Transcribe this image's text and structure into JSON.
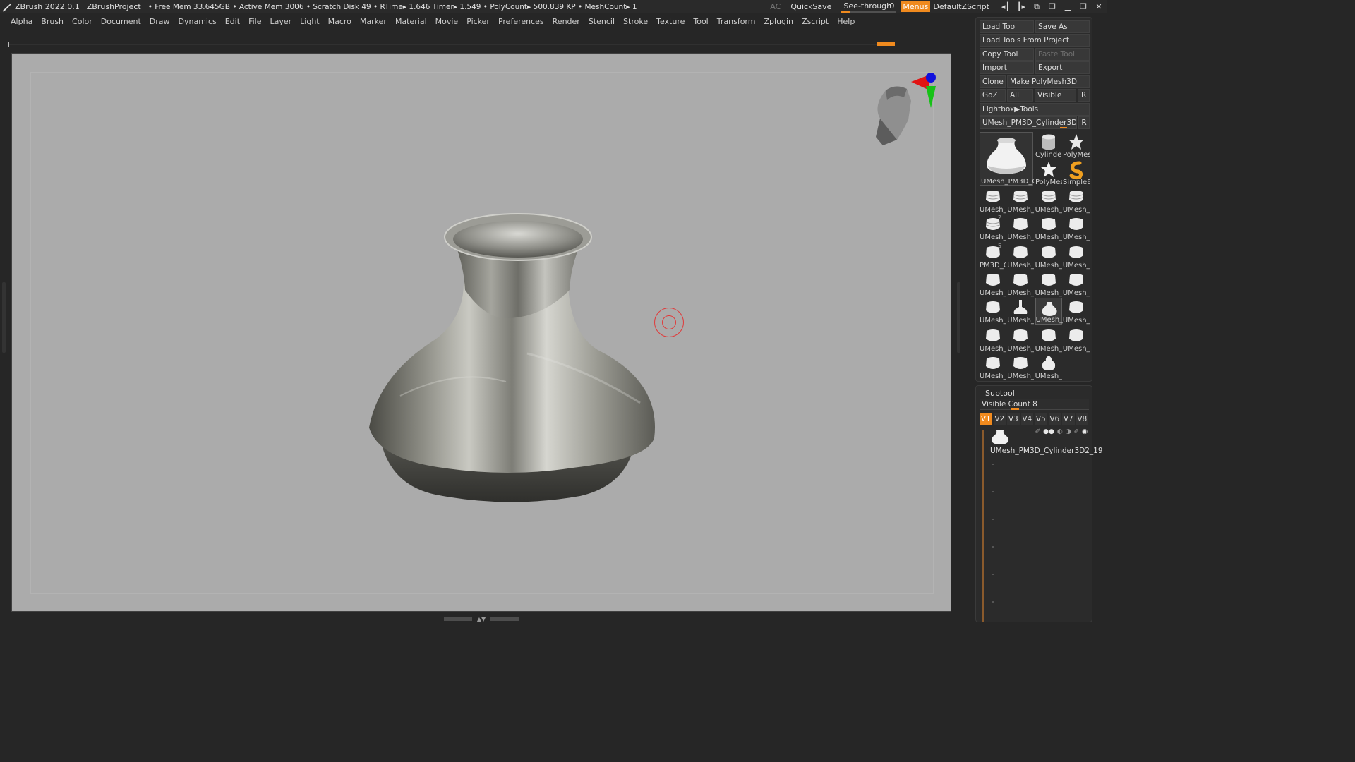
{
  "titlebar": {
    "app": "ZBrush 2022.0.1",
    "project": "ZBrushProject",
    "status": "• Free Mem 33.645GB • Active Mem 3006 • Scratch Disk 49 •  RTime▸ 1.646 Timer▸ 1.549 • PolyCount▸ 500.839 KP  • MeshCount▸ 1",
    "ac": "AC",
    "quicksave": "QuickSave",
    "see_through_label": "See-through",
    "see_through_value": "0",
    "menus": "Menus",
    "default_zscript": "DefaultZScript"
  },
  "menubar": [
    "Alpha",
    "Brush",
    "Color",
    "Document",
    "Draw",
    "Dynamics",
    "Edit",
    "File",
    "Layer",
    "Light",
    "Macro",
    "Marker",
    "Material",
    "Movie",
    "Picker",
    "Preferences",
    "Render",
    "Stencil",
    "Stroke",
    "Texture",
    "Tool",
    "Transform",
    "Zplugin",
    "Zscript",
    "Help"
  ],
  "tool_panel": {
    "load_tool": "Load Tool",
    "save_as": "Save As",
    "load_tools_from_project": "Load Tools From Project",
    "copy_tool": "Copy Tool",
    "paste_tool": "Paste Tool",
    "import": "Import",
    "export": "Export",
    "clone": "Clone",
    "make_polymesh": "Make PolyMesh3D",
    "goz": "GoZ",
    "all": "All",
    "visible": "Visible",
    "r": "R",
    "lightbox_tools": "Lightbox▶Tools",
    "current_tool": "UMesh_PM3D_Cylinder3D2_1",
    "current_tool_r": "R",
    "big_thumb_label": "UMesh_PM3D_C",
    "top_thumbs": [
      {
        "label": "Cylinder",
        "icon": "cylinder-icon"
      },
      {
        "label": "PolyMes",
        "icon": "star-icon"
      },
      {
        "label": "PolyMes",
        "icon": "star-icon"
      },
      {
        "label": "SimpleB",
        "icon": "simplebrush-icon"
      }
    ],
    "grid_thumbs": [
      "UMesh_",
      "UMesh_",
      "UMesh_",
      "UMesh_",
      "UMesh_",
      "UMesh_",
      "UMesh_",
      "UMesh_",
      "PM3D_C",
      "UMesh_",
      "UMesh_",
      "UMesh_",
      "UMesh_",
      "UMesh_",
      "UMesh_",
      "UMesh_",
      "UMesh_",
      "UMesh_",
      "UMesh_",
      "UMesh_",
      "UMesh_",
      "UMesh_",
      "UMesh_",
      "UMesh_",
      "UMesh_",
      "UMesh_",
      "UMesh_"
    ],
    "grid_badges": {
      "4": "2",
      "8": "5"
    }
  },
  "subtool": {
    "title": "Subtool",
    "visible_count": "Visible Count 8",
    "visible_count_value": 8,
    "v_buttons": [
      "V1",
      "V2",
      "V3",
      "V4",
      "V5",
      "V6",
      "V7",
      "V8"
    ],
    "active_v": "V1",
    "item_name": "UMesh_PM3D_Cylinder3D2_19"
  },
  "colors": {
    "accent": "#f08a1e",
    "canvas": "#ababab",
    "panel": "#2b2b2b",
    "cursor_ring": "#e03a3a"
  }
}
